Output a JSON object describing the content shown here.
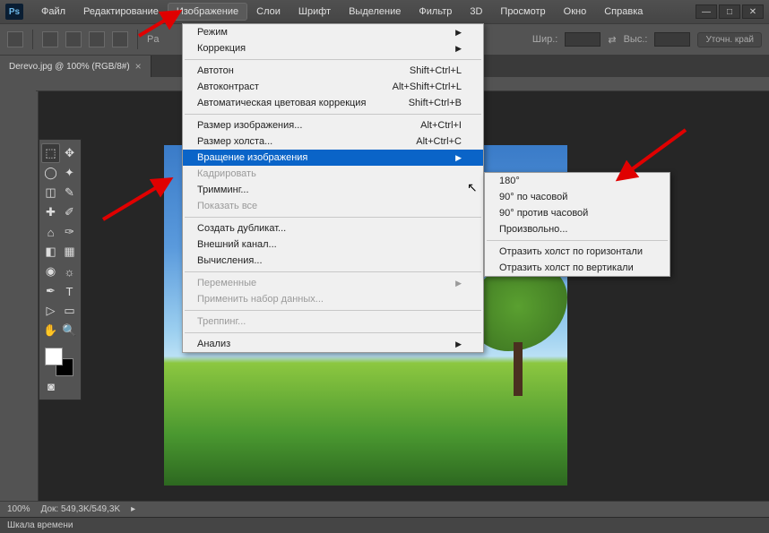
{
  "app": {
    "logo": "Ps"
  },
  "menubar": [
    "Файл",
    "Редактирование",
    "Изображение",
    "Слои",
    "Шрифт",
    "Выделение",
    "Фильтр",
    "3D",
    "Просмотр",
    "Окно",
    "Справка"
  ],
  "menubar_active_index": 2,
  "window_buttons": {
    "minimize": "—",
    "maximize": "□",
    "close": "✕"
  },
  "options_bar": {
    "split_label": "Pa",
    "width_label": "Шир.:",
    "height_label": "Выс.:",
    "refine_btn": "Уточн. край"
  },
  "document_tab": {
    "title": "Derevo.jpg @ 100% (RGB/8#)",
    "close": "×"
  },
  "dropdown_image": {
    "groups": [
      [
        {
          "label": "Режим",
          "submenu": true
        },
        {
          "label": "Коррекция",
          "submenu": true
        }
      ],
      [
        {
          "label": "Автотон",
          "shortcut": "Shift+Ctrl+L"
        },
        {
          "label": "Автоконтраст",
          "shortcut": "Alt+Shift+Ctrl+L"
        },
        {
          "label": "Автоматическая цветовая коррекция",
          "shortcut": "Shift+Ctrl+B"
        }
      ],
      [
        {
          "label": "Размер изображения...",
          "shortcut": "Alt+Ctrl+I"
        },
        {
          "label": "Размер холста...",
          "shortcut": "Alt+Ctrl+C"
        },
        {
          "label": "Вращение изображения",
          "submenu": true,
          "highlighted": true
        },
        {
          "label": "Кадрировать",
          "disabled": true
        },
        {
          "label": "Тримминг..."
        },
        {
          "label": "Показать все",
          "disabled": true
        }
      ],
      [
        {
          "label": "Создать дубликат..."
        },
        {
          "label": "Внешний канал..."
        },
        {
          "label": "Вычисления..."
        }
      ],
      [
        {
          "label": "Переменные",
          "submenu": true,
          "disabled": true
        },
        {
          "label": "Применить набор данных...",
          "disabled": true
        }
      ],
      [
        {
          "label": "Треппинг...",
          "disabled": true
        }
      ],
      [
        {
          "label": "Анализ",
          "submenu": true
        }
      ]
    ]
  },
  "submenu_rotation": {
    "groups": [
      [
        {
          "label": "180°"
        },
        {
          "label": "90° по часовой"
        },
        {
          "label": "90° против часовой"
        },
        {
          "label": "Произвольно..."
        }
      ],
      [
        {
          "label": "Отразить холст по горизонтали"
        },
        {
          "label": "Отразить холст по вертикали"
        }
      ]
    ]
  },
  "tools": [
    [
      "move",
      "⬚",
      "marquee",
      "⬛"
    ],
    [
      "lasso",
      "𝘓",
      "wand",
      "✦"
    ],
    [
      "crop",
      "⬈",
      "eyedropper",
      "✎"
    ],
    [
      "heal",
      "✚",
      "brush",
      "🖌"
    ],
    [
      "stamp",
      "⌂",
      "history",
      "✑"
    ],
    [
      "eraser",
      "◧",
      "gradient",
      "▤"
    ],
    [
      "blur",
      "◉",
      "dodge",
      "☼"
    ],
    [
      "pen",
      "✒",
      "type",
      "T"
    ],
    [
      "path",
      "▷",
      "shape",
      "▭"
    ],
    [
      "hand",
      "✋",
      "zoom",
      "🔍"
    ]
  ],
  "statusbar": {
    "zoom": "100%",
    "doc_info": "Док: 549,3K/549,3K",
    "arrow": "▸"
  },
  "timeline": {
    "label": "Шкала времени"
  }
}
